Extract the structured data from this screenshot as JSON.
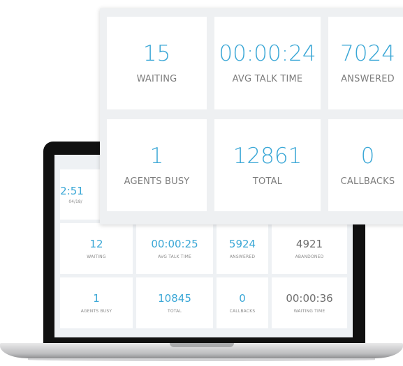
{
  "colors": {
    "accent": "#3aa7d6",
    "muted_text": "#6e6e6e",
    "laptop_bezel": "#101010"
  },
  "panel": {
    "tiles": [
      {
        "value": "15",
        "label": "WAITING"
      },
      {
        "value": "00:00:24",
        "label": "AVG TALK TIME"
      },
      {
        "value": "7024",
        "label": "ANSWERED"
      },
      {
        "value": "1",
        "label": "AGENTS BUSY"
      },
      {
        "value": "12861",
        "label": "TOTAL"
      },
      {
        "value": "0",
        "label": "CALLBACKS"
      }
    ]
  },
  "laptop": {
    "clock": {
      "time": "2:51",
      "date": "04/18/"
    },
    "tiles": [
      {
        "value": "12",
        "label": "WAITING"
      },
      {
        "value": "00:00:25",
        "label": "AVG TALK TIME"
      },
      {
        "value": "5924",
        "label": "ANSWERED"
      },
      {
        "value": "4921",
        "label": "ABANDONED"
      },
      {
        "value": "1",
        "label": "AGENTS BUSY"
      },
      {
        "value": "10845",
        "label": "TOTAL"
      },
      {
        "value": "0",
        "label": "CALLBACKS"
      },
      {
        "value": "00:00:36",
        "label": "WAITING TIME"
      }
    ]
  }
}
